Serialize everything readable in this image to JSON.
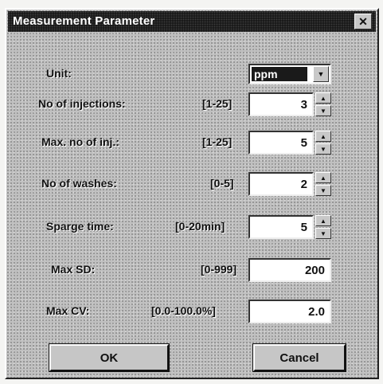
{
  "dialog": {
    "title": "Measurement Parameter",
    "close_glyph": "✕"
  },
  "unit": {
    "label": "Unit:",
    "value": "ppm"
  },
  "fields": [
    {
      "label": "No of injections:",
      "range": "[1-25]",
      "value": "3",
      "spinner": true
    },
    {
      "label": "Max. no of inj.:",
      "range": "[1-25]",
      "value": "5",
      "spinner": true
    },
    {
      "label": "No of washes:",
      "range": "[0-5]",
      "value": "2",
      "spinner": true
    },
    {
      "label": "Sparge time:",
      "range": "[0-20min]",
      "value": "5",
      "spinner": true
    },
    {
      "label": "Max SD:",
      "range": "[0-999]",
      "value": "200",
      "spinner": false
    },
    {
      "label": "Max CV:",
      "range": "[0.0-100.0%]",
      "value": "2.0",
      "spinner": false
    }
  ],
  "buttons": {
    "ok": "OK",
    "cancel": "Cancel"
  },
  "icons": {
    "up": "▲",
    "down": "▼"
  }
}
